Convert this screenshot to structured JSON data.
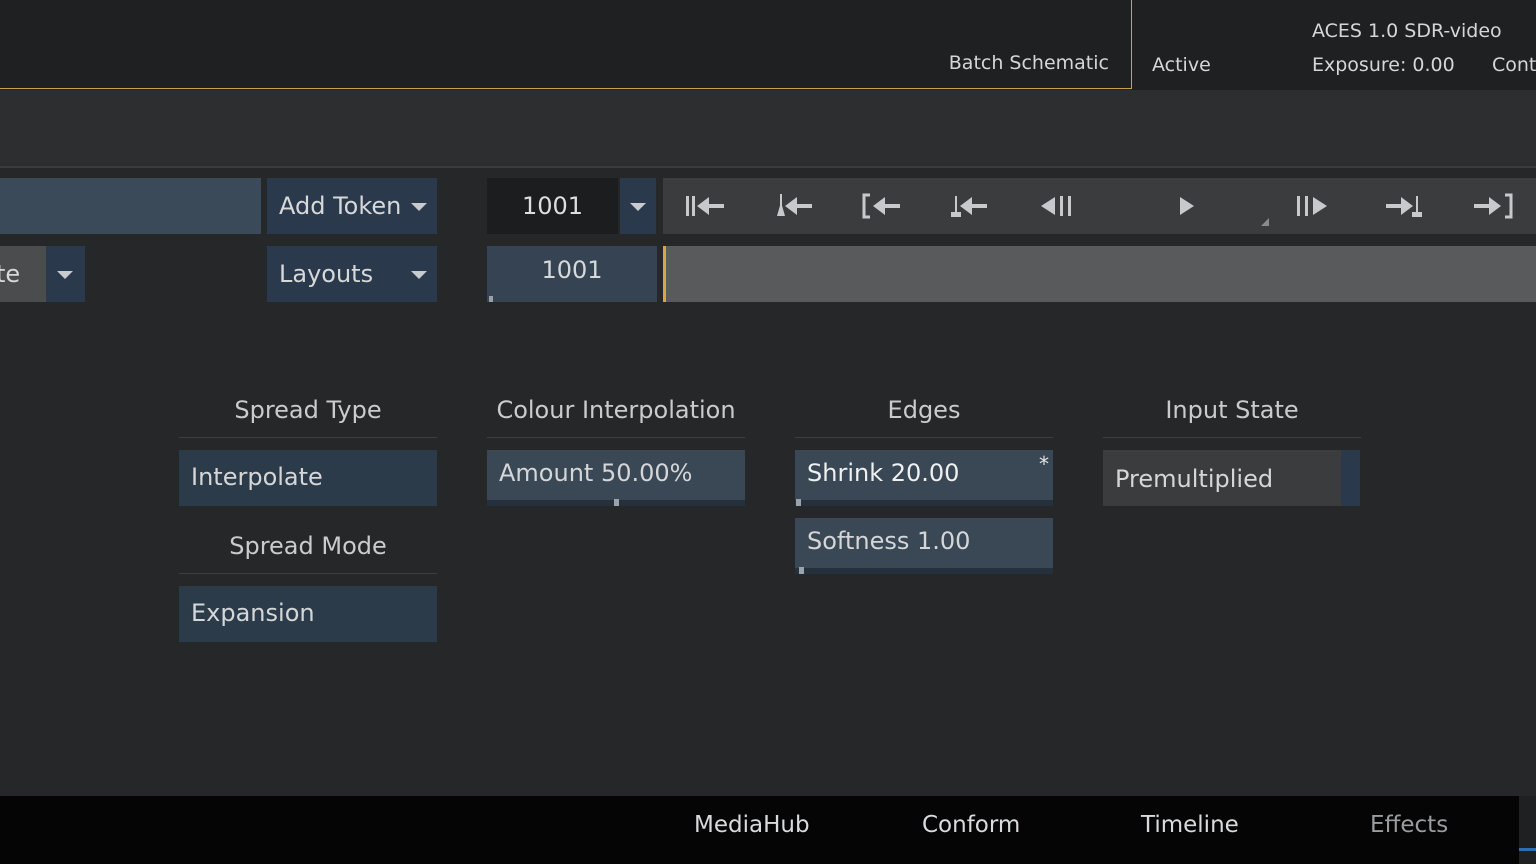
{
  "header": {
    "view_name": "Batch Schematic",
    "status": "Active",
    "colour_space": "ACES 1.0 SDR-video",
    "exposure": "Exposure: 0.00",
    "contrast": "Cont"
  },
  "controls": {
    "name_value": "",
    "add_token_label": "Add Token",
    "preset_value": "te",
    "layouts_label": "Layouts",
    "frame_value": "1001",
    "current_frame": "1001"
  },
  "transport": {
    "icons": [
      "go-to-start-icon",
      "previous-keyframe-icon",
      "go-to-in-point-icon",
      "previous-frame-icon",
      "play-backward-icon",
      "play-icon",
      "step-forward-icon",
      "next-keyframe-icon",
      "go-to-end-icon"
    ]
  },
  "params": {
    "spread_type_title": "Spread Type",
    "spread_type_value": "Interpolate",
    "spread_mode_title": "Spread Mode",
    "spread_mode_value": "Expansion",
    "colour_title": "Colour Interpolation",
    "amount_label": "Amount 50.00%",
    "amount_fraction": 0.5,
    "edges_title": "Edges",
    "shrink_label": "Shrink 20.00",
    "shrink_modified_mark": "*",
    "softness_label": "Softness 1.00",
    "input_state_title": "Input State",
    "input_state_value": "Premultiplied"
  },
  "tabs": [
    {
      "label": "MediaHub",
      "active": false
    },
    {
      "label": "Conform",
      "active": false
    },
    {
      "label": "Timeline",
      "active": false
    },
    {
      "label": "Effects",
      "active": true
    }
  ],
  "colors": {
    "accent": "#d9a640",
    "active_tab_marker": "#2f6db0",
    "field_blue": "#2b3a4a"
  }
}
